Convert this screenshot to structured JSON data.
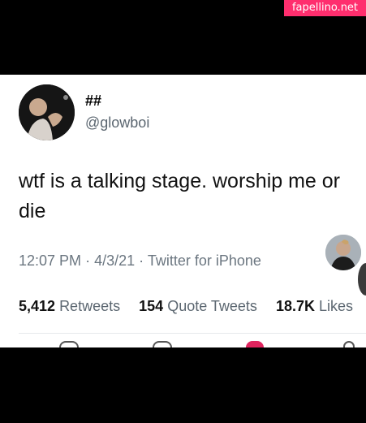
{
  "watermark": "fapellino.net",
  "tweet": {
    "display_name": "##",
    "handle": "@glowboi",
    "text": "wtf is a talking stage. worship me or\ndie",
    "time": "12:07 PM",
    "date": "4/3/21",
    "source": "Twitter for iPhone",
    "retweets_count": "5,412",
    "retweets_label": "Retweets",
    "quote_count": "154",
    "quote_label": "Quote Tweets",
    "likes_count": "18.7K",
    "likes_label": "Likes"
  },
  "colors": {
    "watermark_bg": "#ff2e6e",
    "like": "#e0245e"
  }
}
